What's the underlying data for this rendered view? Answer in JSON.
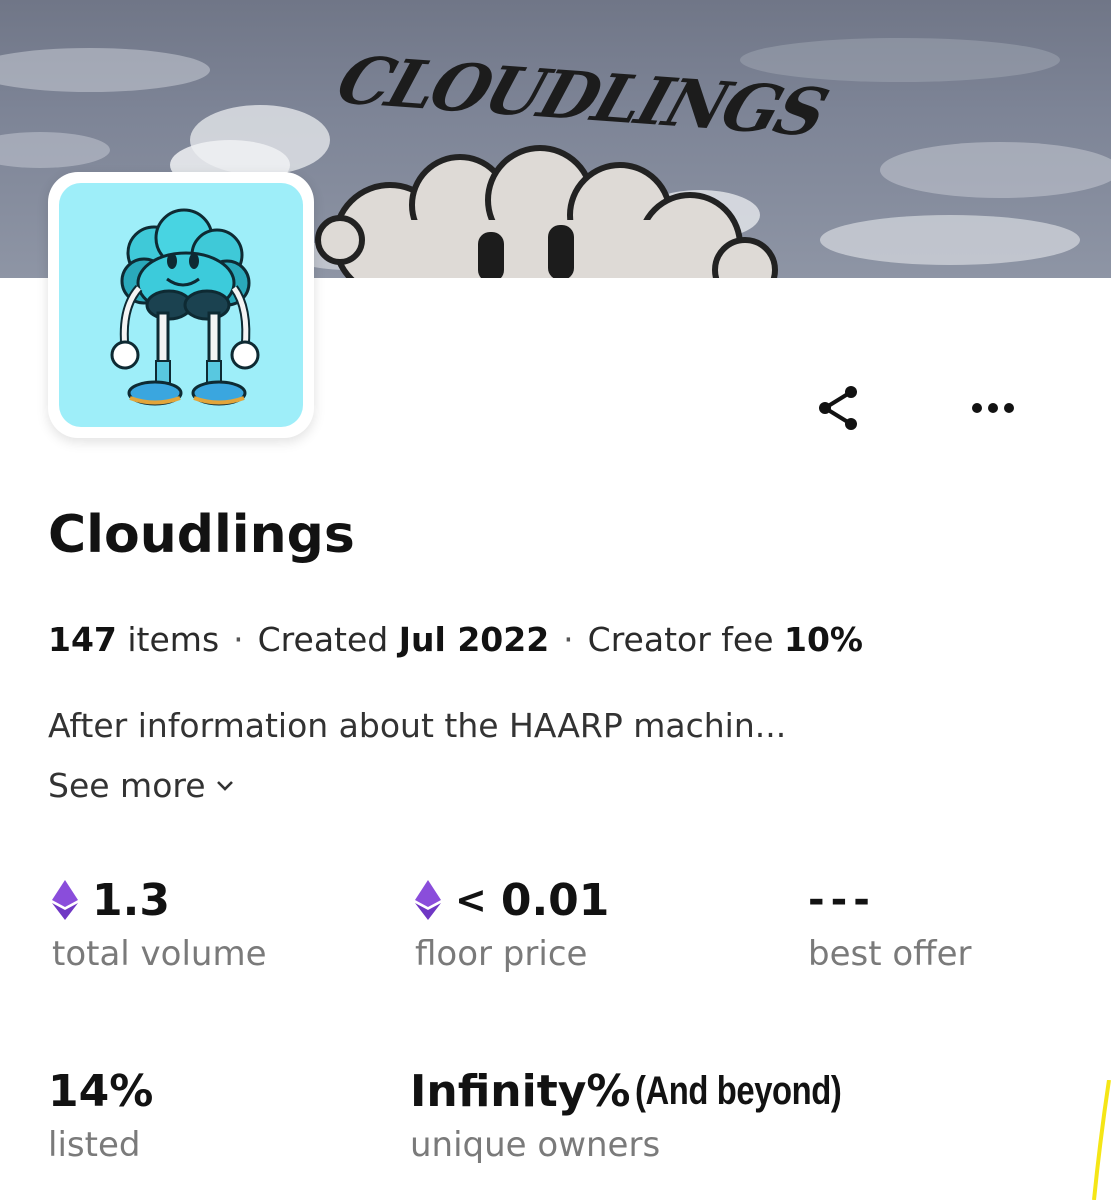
{
  "banner": {
    "title_art": "CLOUDLINGS",
    "sky_color": "#7d8496"
  },
  "collection": {
    "name": "Cloudlings",
    "items_count": "147",
    "items_label": "items",
    "created_label": "Created",
    "created_date": "Jul 2022",
    "fee_label": "Creator fee",
    "fee_value": "10%",
    "separator": "·",
    "description": "After information about the HAARP machin...",
    "see_more_label": "See more"
  },
  "actions": {
    "share_icon": "share-icon",
    "more_icon": "more-options-icon"
  },
  "stats": {
    "total_volume": {
      "value": "1.3",
      "label": "total volume",
      "currency_icon": "ethereum-icon"
    },
    "floor_price": {
      "prefix": "<",
      "value": "0.01",
      "label": "floor price",
      "currency_icon": "ethereum-icon"
    },
    "best_offer": {
      "value": "---",
      "label": "best offer"
    },
    "listed": {
      "value": "14%",
      "label": "listed"
    },
    "unique_owners": {
      "value": "Infinity%",
      "extra": "(And beyond)",
      "label": "unique owners"
    }
  },
  "colors": {
    "avatar_bg": "#9eeef9",
    "eth_purple": "#8a4ddb",
    "accent_yellow": "#f5e616"
  }
}
